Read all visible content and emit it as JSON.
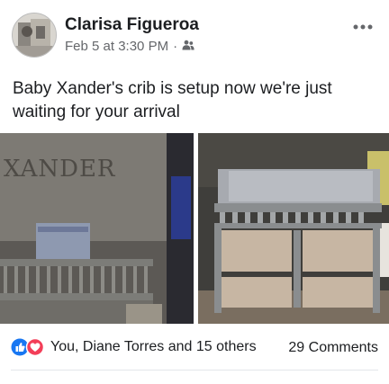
{
  "post": {
    "author_name": "Clarisa Figueroa",
    "timestamp": "Feb 5 at 3:30 PM",
    "separator": "·",
    "audience_icon": "friends-icon",
    "more_icon": "more-options-icon",
    "text": "Baby Xander's crib is setup now we're just waiting for your arrival"
  },
  "photos": {
    "left": {
      "sign_text": "XANDER"
    }
  },
  "footer": {
    "reaction_icons": [
      "like-icon",
      "love-icon"
    ],
    "reactions_text": "You, Diane Torres and 15 others",
    "comments_text": "29 Comments"
  },
  "colors": {
    "like_blue": "#1877f2",
    "love_red": "#f33e58",
    "secondary_text": "#65676b"
  }
}
